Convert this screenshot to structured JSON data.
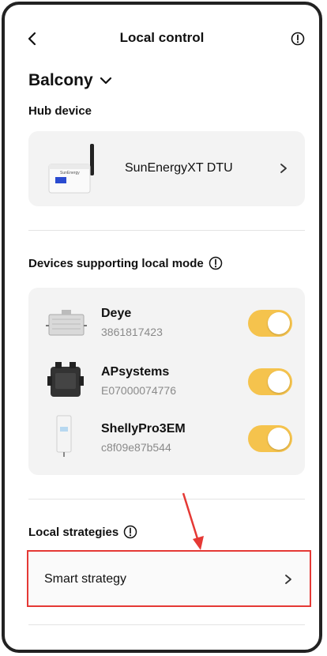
{
  "header": {
    "title": "Local control"
  },
  "location": {
    "name": "Balcony"
  },
  "hub": {
    "section_label": "Hub device",
    "device_name": "SunEnergyXT DTU"
  },
  "devices": {
    "section_label": "Devices supporting local mode",
    "items": [
      {
        "name": "Deye",
        "id": "3861817423",
        "enabled": true
      },
      {
        "name": "APsystems",
        "id": "E07000074776",
        "enabled": true
      },
      {
        "name": "ShellyPro3EM",
        "id": "c8f09e87b544",
        "enabled": true
      }
    ]
  },
  "strategies": {
    "section_label": "Local strategies",
    "item_label": "Smart strategy"
  },
  "colors": {
    "toggle_on": "#f5c34d",
    "highlight": "#e53935",
    "card_bg": "#f3f3f3"
  }
}
